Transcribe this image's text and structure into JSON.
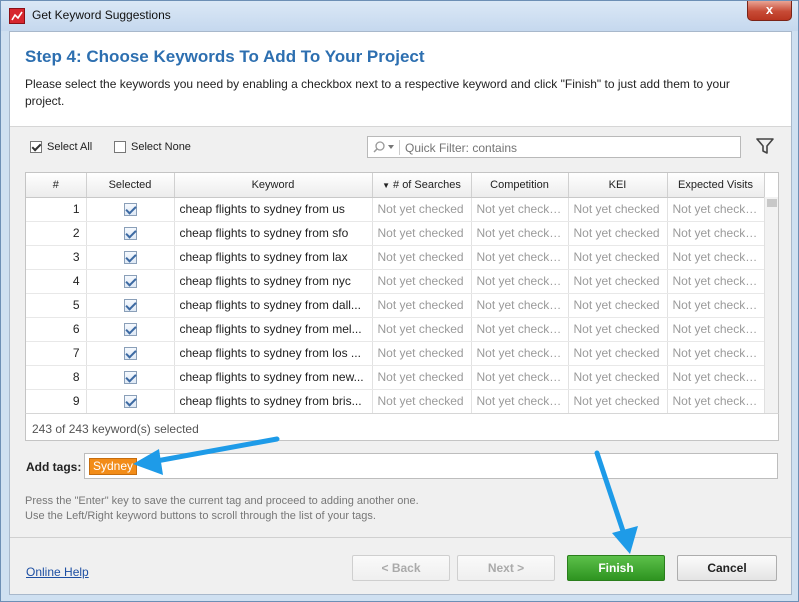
{
  "window": {
    "title": "Get Keyword Suggestions",
    "close_symbol": "x"
  },
  "header": {
    "step_title": "Step 4: Choose Keywords To Add To Your Project",
    "description": "Please select the keywords you need by enabling a checkbox next to a respective keyword and click \"Finish\" to just add them to your project."
  },
  "toolbar": {
    "select_all_label": "Select All",
    "select_none_label": "Select None",
    "filter_placeholder": "Quick Filter: contains"
  },
  "grid": {
    "columns": [
      "#",
      "Selected",
      "Keyword",
      "# of Searches",
      "Competition",
      "KEI",
      "Expected Visits"
    ],
    "sort_indicator": "▼",
    "placeholder_value": "Not yet checked",
    "rows": [
      {
        "num": "1",
        "keyword": "cheap flights to sydney from us"
      },
      {
        "num": "2",
        "keyword": "cheap flights to sydney from sfo"
      },
      {
        "num": "3",
        "keyword": "cheap flights to sydney from lax"
      },
      {
        "num": "4",
        "keyword": "cheap flights to sydney from nyc"
      },
      {
        "num": "5",
        "keyword": "cheap flights to sydney from dall..."
      },
      {
        "num": "6",
        "keyword": "cheap flights to sydney from mel..."
      },
      {
        "num": "7",
        "keyword": "cheap flights to sydney from los ..."
      },
      {
        "num": "8",
        "keyword": "cheap flights to sydney from new..."
      },
      {
        "num": "9",
        "keyword": "cheap flights to sydney from bris..."
      }
    ]
  },
  "status": {
    "selected_count": "243 of 243 keyword(s) selected"
  },
  "tags": {
    "label": "Add tags:",
    "current_tag": "Sydney"
  },
  "hint": {
    "line1": "Press the \"Enter\" key to save the current tag and proceed to adding another one.",
    "line2": "Use the Left/Right keyword buttons to scroll through the list of your tags."
  },
  "footer": {
    "help_label": "Online Help",
    "back_label": "< Back",
    "next_label": "Next >",
    "finish_label": "Finish",
    "cancel_label": "Cancel"
  },
  "colors": {
    "accent_title": "#2d6fb0",
    "finish_green": "#3aa02a",
    "tag_orange": "#f28c18",
    "annotation_arrow": "#1e9be8"
  }
}
